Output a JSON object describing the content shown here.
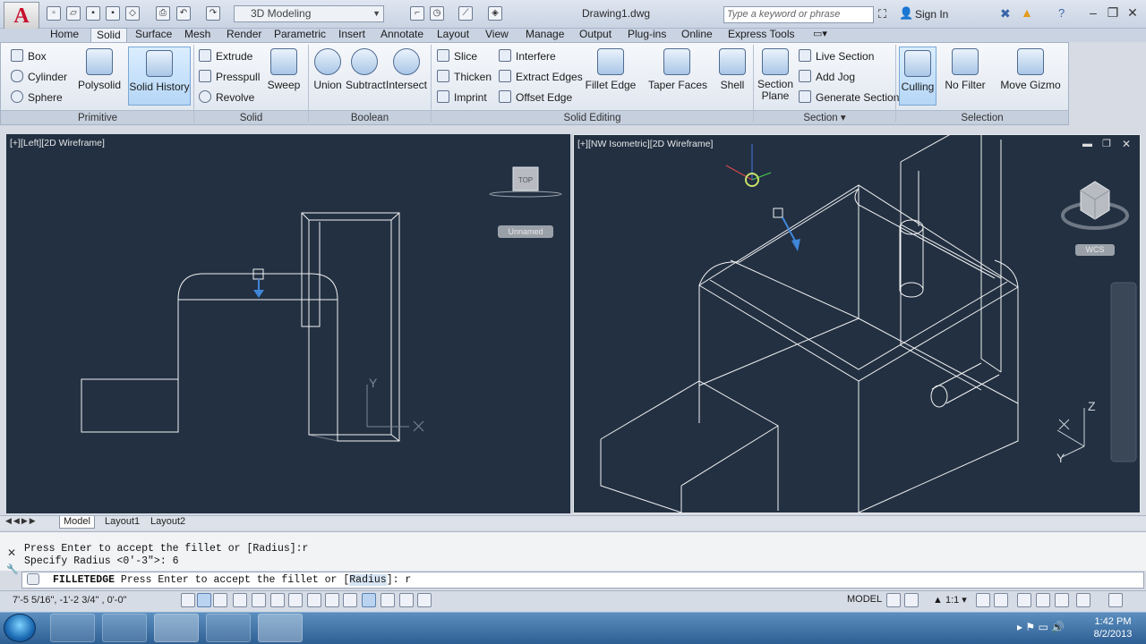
{
  "app": {
    "logo": "A",
    "workspace": "3D Modeling",
    "document_title": "Drawing1.dwg",
    "search_placeholder": "Type a keyword or phrase",
    "sign_in": "Sign In"
  },
  "tabs": [
    "Home",
    "Solid",
    "Surface",
    "Mesh",
    "Render",
    "Parametric",
    "Insert",
    "Annotate",
    "Layout",
    "View",
    "Manage",
    "Output",
    "Plug-ins",
    "Online",
    "Express Tools"
  ],
  "active_tab": "Solid",
  "ribbon": {
    "primitive": {
      "title": "Primitive",
      "small": [
        "Box",
        "Cylinder",
        "Sphere"
      ],
      "large": [
        "Polysolid",
        "Solid History"
      ]
    },
    "solid": {
      "title": "Solid",
      "small": [
        "Extrude",
        "Presspull",
        "Revolve"
      ],
      "large": [
        "Sweep"
      ]
    },
    "boolean": {
      "title": "Boolean",
      "large": [
        "Union",
        "Subtract",
        "Intersect"
      ]
    },
    "solid_editing": {
      "title": "Solid Editing",
      "small_a": [
        "Slice",
        "Thicken",
        "Imprint"
      ],
      "small_b": [
        "Interfere",
        "Extract Edges",
        "Offset Edge"
      ],
      "large": [
        "Fillet Edge",
        "Taper Faces",
        "Shell"
      ]
    },
    "section": {
      "title": "Section",
      "large": [
        "Section\nPlane"
      ],
      "small": [
        "Live Section",
        "Add Jog",
        "Generate Section"
      ]
    },
    "selection": {
      "title": "Selection",
      "large": [
        "Culling",
        "No Filter",
        "Move Gizmo"
      ]
    }
  },
  "viewports": {
    "left": {
      "label": "[+][Left][2D Wireframe]",
      "viewcube_top": "TOP",
      "ucs": "Unnamed"
    },
    "right": {
      "label": "[+][NW Isometric][2D Wireframe]",
      "ucs": "WCS"
    }
  },
  "layout_tabs": [
    "Model",
    "Layout1",
    "Layout2"
  ],
  "command": {
    "history": [
      "Press Enter to accept the fillet or [Radius]:r",
      "Specify Radius <0'-3\">: 6"
    ],
    "prompt_cmd": "FILLETEDGE",
    "prompt_text": "Press Enter to accept the fillet or [",
    "prompt_option": "Radius",
    "prompt_tail": "]: r"
  },
  "status": {
    "coords": "7'-5 5/16\",  -1'-2 3/4\"  , 0'-0\"",
    "model": "MODEL",
    "scale": "1:1"
  },
  "taskbar": {
    "time": "1:42 PM",
    "date": "8/2/2013"
  },
  "colors": {
    "viewport_bg": "#223042",
    "wire": "#f2f2f2",
    "accent": "#3f86d9"
  }
}
